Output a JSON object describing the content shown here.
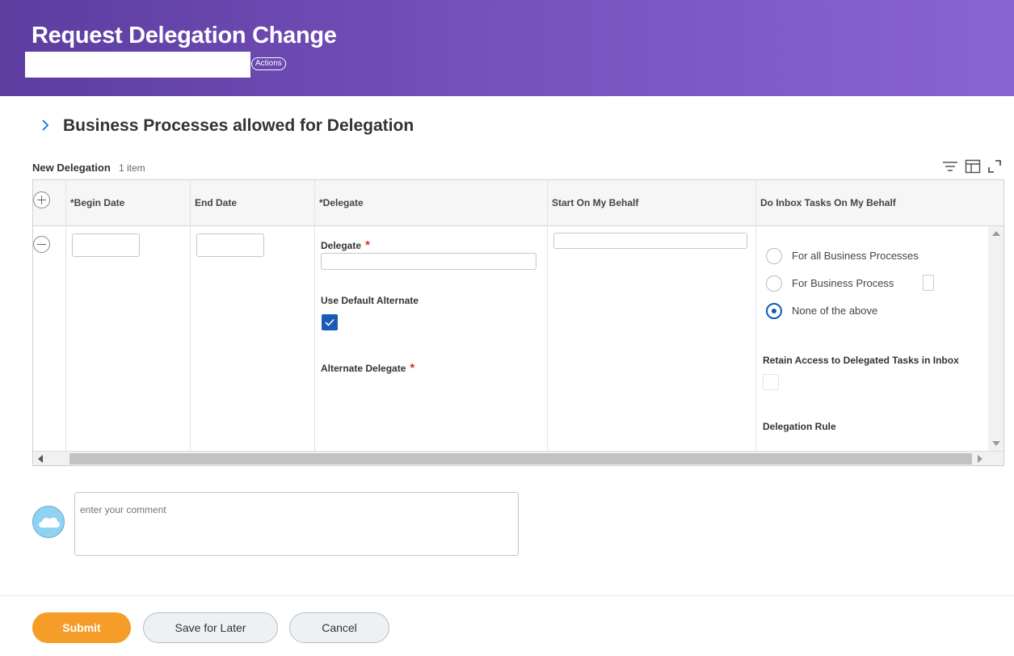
{
  "header": {
    "title": "Request Delegation Change",
    "actions_label": "Actions"
  },
  "section": {
    "title": "Business Processes allowed for Delegation"
  },
  "grid": {
    "title": "New Delegation",
    "count": "1 item",
    "columns": [
      "*Begin Date",
      "End Date",
      "*Delegate",
      "Start On My Behalf",
      "Do Inbox Tasks On My Behalf"
    ],
    "delegate_label": "Delegate",
    "use_default_alternate_label": "Use Default Alternate",
    "use_default_alternate_checked": true,
    "alternate_delegate_label": "Alternate Delegate",
    "radio_options": [
      "For all Business Processes",
      "For Business Process",
      "None of the above"
    ],
    "radio_selected": "None of the above",
    "retain_access_label": "Retain Access to Delegated Tasks in Inbox",
    "delegation_rule_label": "Delegation Rule"
  },
  "comment": {
    "placeholder": "enter your comment"
  },
  "footer": {
    "submit_label": "Submit",
    "save_label": "Save for Later",
    "cancel_label": "Cancel"
  },
  "colors": {
    "header_start": "#5d3da0",
    "header_end": "#8a63d2",
    "submit": "#f59d28",
    "checkbox": "#1a5bb5"
  }
}
